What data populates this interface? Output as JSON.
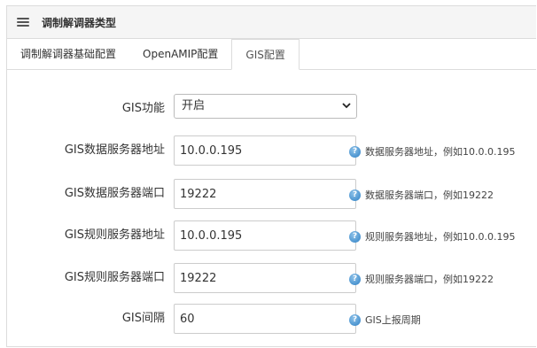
{
  "header": {
    "title": "调制解调器类型",
    "menu_icon": "hamburger-menu-icon"
  },
  "tabs": [
    {
      "label": "调制解调器基础配置",
      "active": false
    },
    {
      "label": "OpenAMIP配置",
      "active": false
    },
    {
      "label": "GIS配置",
      "active": true
    }
  ],
  "form": {
    "gis_function": {
      "label": "GIS功能",
      "value": "开启"
    },
    "gis_data_server_addr": {
      "label": "GIS数据服务器地址",
      "value": "10.0.0.195",
      "help": "数据服务器地址，例如10.0.0.195"
    },
    "gis_data_server_port": {
      "label": "GIS数据服务器端口",
      "value": "19222",
      "help": "数据服务器端口，例如19222"
    },
    "gis_rule_server_addr": {
      "label": "GIS规则服务器地址",
      "value": "10.0.0.195",
      "help": "规则服务器地址，例如10.0.0.195"
    },
    "gis_rule_server_port": {
      "label": "GIS规则服务器端口",
      "value": "19222",
      "help": "规则服务器端口，例如19222"
    },
    "gis_interval": {
      "label": "GIS间隔",
      "value": "60",
      "help": "GIS上报周期"
    }
  },
  "colors": {
    "border": "#dcdcdc",
    "header_bg": "#f5f5f5",
    "help_icon": "#2d7fc4"
  }
}
